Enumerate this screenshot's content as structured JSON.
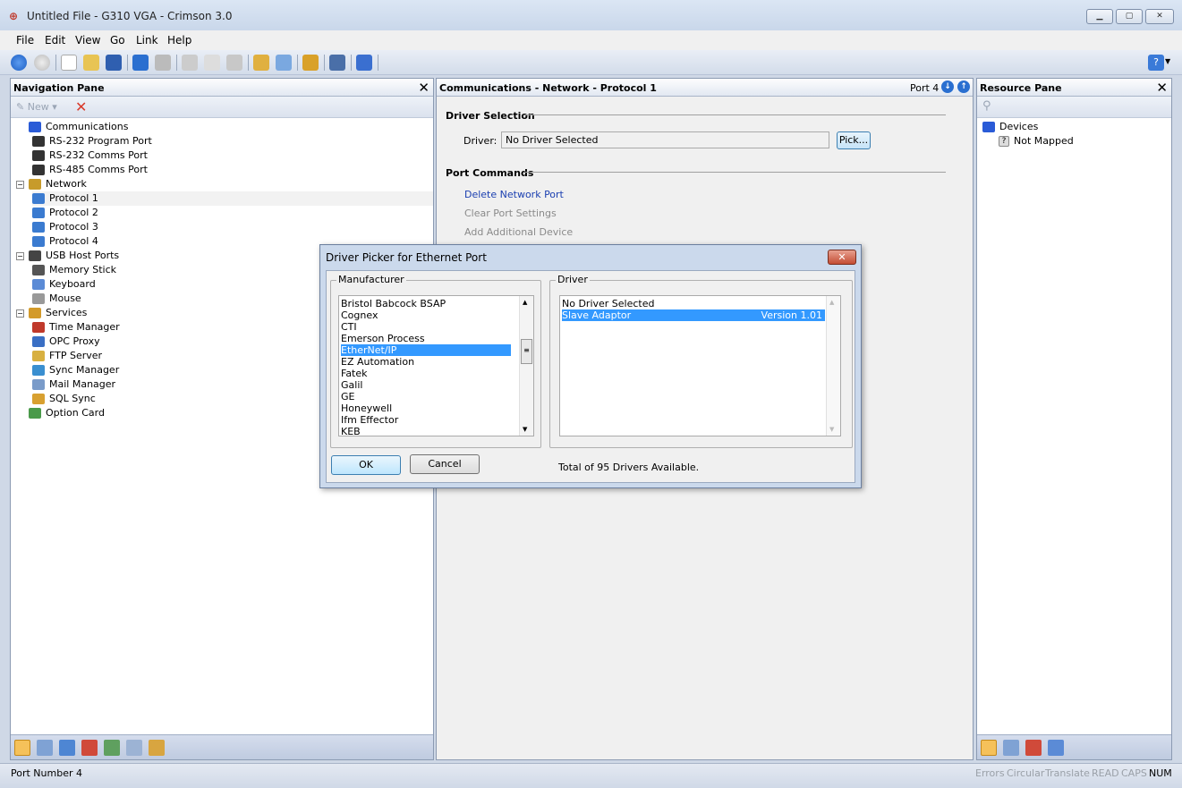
{
  "window": {
    "title": "Untitled File - G310 VGA - Crimson 3.0"
  },
  "menu": [
    "File",
    "Edit",
    "View",
    "Go",
    "Link",
    "Help"
  ],
  "nav": {
    "title": "Navigation Pane",
    "new_label": "New",
    "tree": [
      {
        "label": "Communications",
        "level": 0,
        "expander": "",
        "icon": "#2a5bd7"
      },
      {
        "label": "RS-232 Program Port",
        "level": 1,
        "expander": "",
        "icon": "#333"
      },
      {
        "label": "RS-232 Comms Port",
        "level": 1,
        "expander": "",
        "icon": "#333"
      },
      {
        "label": "RS-485 Comms Port",
        "level": 1,
        "expander": "",
        "icon": "#333"
      },
      {
        "label": "Network",
        "level": 0,
        "expander": "−",
        "icon": "#c79b2b"
      },
      {
        "label": "Protocol 1",
        "level": 1,
        "expander": "",
        "icon": "#3b7bd0",
        "selected": true
      },
      {
        "label": "Protocol 2",
        "level": 1,
        "expander": "",
        "icon": "#3b7bd0"
      },
      {
        "label": "Protocol 3",
        "level": 1,
        "expander": "",
        "icon": "#3b7bd0"
      },
      {
        "label": "Protocol 4",
        "level": 1,
        "expander": "",
        "icon": "#3b7bd0"
      },
      {
        "label": "USB Host Ports",
        "level": 0,
        "expander": "−",
        "icon": "#444"
      },
      {
        "label": "Memory Stick",
        "level": 1,
        "expander": "",
        "icon": "#555"
      },
      {
        "label": "Keyboard",
        "level": 1,
        "expander": "",
        "icon": "#5b8bd6"
      },
      {
        "label": "Mouse",
        "level": 1,
        "expander": "",
        "icon": "#999"
      },
      {
        "label": "Services",
        "level": 0,
        "expander": "−",
        "icon": "#d39a2a"
      },
      {
        "label": "Time Manager",
        "level": 1,
        "expander": "",
        "icon": "#c0392b"
      },
      {
        "label": "OPC Proxy",
        "level": 1,
        "expander": "",
        "icon": "#3a6fc4"
      },
      {
        "label": "FTP Server",
        "level": 1,
        "expander": "",
        "icon": "#d8b040"
      },
      {
        "label": "Sync Manager",
        "level": 1,
        "expander": "",
        "icon": "#3a8fd0"
      },
      {
        "label": "Mail Manager",
        "level": 1,
        "expander": "",
        "icon": "#7a9bc9"
      },
      {
        "label": "SQL Sync",
        "level": 1,
        "expander": "",
        "icon": "#d8a030"
      },
      {
        "label": "Option Card",
        "level": 0,
        "expander": "",
        "icon": "#4a9a4a"
      }
    ]
  },
  "main": {
    "title": "Communications - Network - Protocol 1",
    "port_label": "Port 4",
    "driver_section": "Driver Selection",
    "driver_label": "Driver:",
    "driver_value": "No Driver Selected",
    "pick_label": "Pick...",
    "port_commands": "Port Commands",
    "commands": [
      {
        "label": "Delete Network Port",
        "enabled": true
      },
      {
        "label": "Clear Port Settings",
        "enabled": false
      },
      {
        "label": "Add Additional Device",
        "enabled": false
      }
    ]
  },
  "resource": {
    "title": "Resource Pane",
    "devices_label": "Devices",
    "not_mapped_label": "Not Mapped"
  },
  "dialog": {
    "title": "Driver Picker for Ethernet Port",
    "manufacturer_label": "Manufacturer",
    "driver_label": "Driver",
    "manufacturers": [
      "Bristol Babcock BSAP",
      "Cognex",
      "CTI",
      "Emerson Process",
      "EtherNet/IP",
      "EZ Automation",
      "Fatek",
      "Galil",
      "GE",
      "Honeywell",
      "Ifm Effector",
      "KEB"
    ],
    "selected_manufacturer": "EtherNet/IP",
    "drivers": [
      {
        "name": "No Driver Selected",
        "version": ""
      },
      {
        "name": "Slave Adaptor",
        "version": "Version 1.01"
      }
    ],
    "selected_driver": "Slave Adaptor",
    "ok_label": "OK",
    "cancel_label": "Cancel",
    "total_text": "Total of 95 Drivers Available."
  },
  "status": {
    "left": "Port Number 4",
    "indicators": [
      {
        "label": "Errors",
        "active": false
      },
      {
        "label": "Circular",
        "active": false
      },
      {
        "label": "Translate",
        "active": false
      },
      {
        "label": "READ",
        "active": false
      },
      {
        "label": "CAPS",
        "active": false
      },
      {
        "label": "NUM",
        "active": true
      }
    ]
  }
}
